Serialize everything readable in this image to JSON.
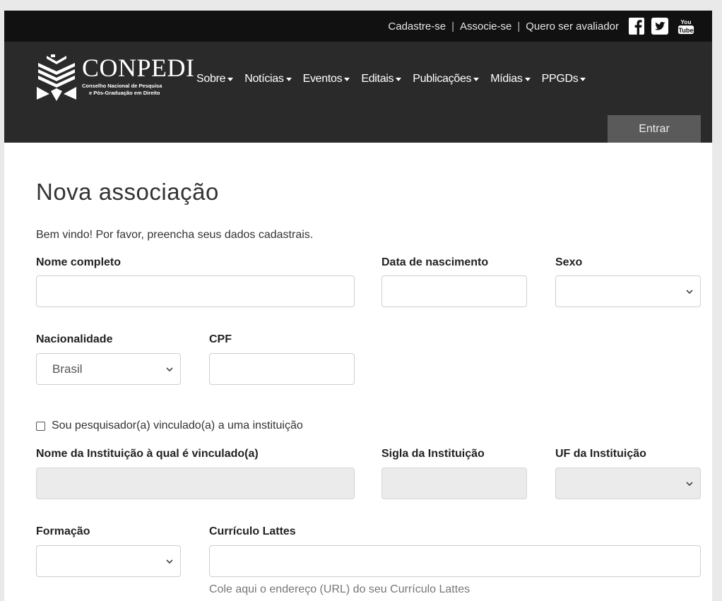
{
  "header": {
    "links": [
      "Cadastre-se",
      "Associe-se",
      "Quero ser avaliador"
    ],
    "social": [
      "facebook-icon",
      "twitter-icon",
      "youtube-icon"
    ],
    "youtube_text_top": "You",
    "youtube_text_bottom": "Tube"
  },
  "logo": {
    "name": "CONPEDI",
    "subtitle_line1": "Conselho Nacional de Pesquisa",
    "subtitle_line2": "e Pós-Graduação em Direito"
  },
  "nav": {
    "items": [
      "Sobre",
      "Notícias",
      "Eventos",
      "Editais",
      "Publicações",
      "Mídias",
      "PPGDs"
    ],
    "login_label": "Entrar"
  },
  "form": {
    "title": "Nova associação",
    "intro": "Bem vindo! Por favor, preencha seus dados cadastrais.",
    "labels": {
      "nome": "Nome completo",
      "nascimento": "Data de nascimento",
      "sexo": "Sexo",
      "nacionalidade": "Nacionalidade",
      "cpf": "CPF",
      "pesquisador": "Sou pesquisador(a) vinculado(a) a uma instituição",
      "instituicao": "Nome da Instituição à qual é vinculado(a)",
      "sigla": "Sigla da Instituição",
      "uf": "UF da Instituição",
      "formacao": "Formação",
      "lattes": "Currículo Lattes"
    },
    "values": {
      "nome": "",
      "nascimento": "",
      "sexo": "",
      "nacionalidade": "Brasil",
      "cpf": "",
      "instituicao": "",
      "sigla": "",
      "uf": "",
      "formacao": "",
      "lattes": ""
    },
    "lattes_help": "Cole aqui o endereço (URL) do seu Currículo Lattes",
    "pesquisador_checked": false
  },
  "colors": {
    "topbar": "#111111",
    "navbar": "#2a2a2a",
    "login_button": "#5a5a5a",
    "disabled_field": "#ebebeb"
  }
}
